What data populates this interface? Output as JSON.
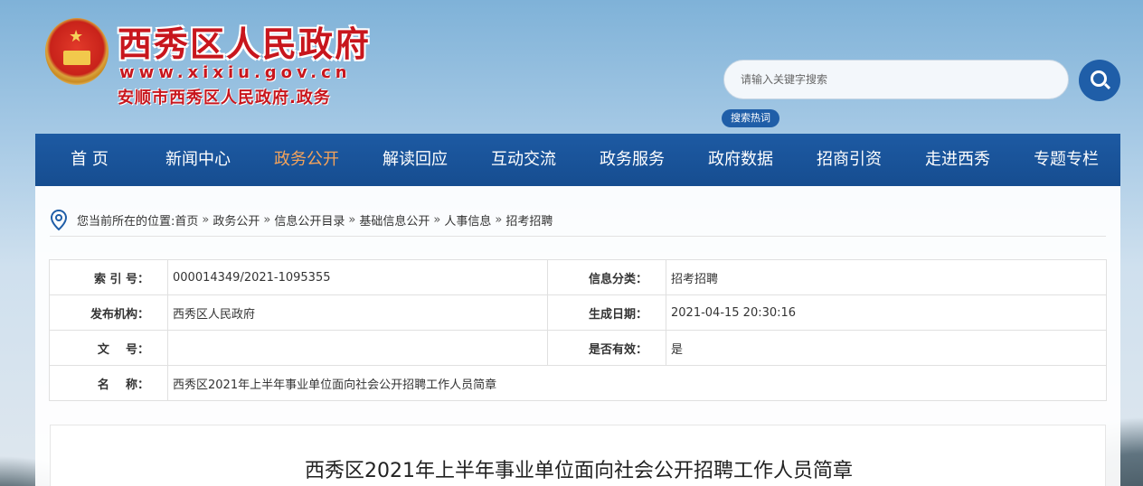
{
  "header": {
    "site_title": "西秀区人民政府",
    "site_url": "www.xixiu.gov.cn",
    "site_subtitle": "安顺市西秀区人民政府.政务"
  },
  "search": {
    "placeholder": "请输入关键字搜索",
    "hot_label": "搜索热词"
  },
  "nav": {
    "items": [
      "首 页",
      "新闻中心",
      "政务公开",
      "解读回应",
      "互动交流",
      "政务服务",
      "政府数据",
      "招商引资",
      "走进西秀",
      "专题专栏"
    ],
    "active": "政务公开",
    "active_color": "#f5a35a",
    "bar_color": "#1d5aa3"
  },
  "breadcrumb": {
    "prefix": "您当前所在的位置:",
    "items": [
      "首页",
      "政务公开",
      "信息公开目录",
      "基础信息公开",
      "人事信息",
      "招考招聘"
    ],
    "separator": "»"
  },
  "info": {
    "index_label": "索 引 号：",
    "index_value": "000014349/2021-1095355",
    "category_label": "信息分类：",
    "category_value": "招考招聘",
    "publisher_label": "发布机构：",
    "publisher_value": "西秀区人民政府",
    "date_label": "生成日期：",
    "date_value": "2021-04-15 20:30:16",
    "docno_label": "文    号：",
    "docno_value": "",
    "valid_label": "是否有效：",
    "valid_value": "是",
    "name_label": "名    称：",
    "name_value": "西秀区2021年上半年事业单位面向社会公开招聘工作人员简章"
  },
  "article": {
    "title": "西秀区2021年上半年事业单位面向社会公开招聘工作人员简章"
  },
  "colors": {
    "brand_red": "#c8161d",
    "brand_blue": "#1f5ea8"
  },
  "icons": {
    "search": "search-icon",
    "location": "location-pin-icon",
    "emblem": "national-emblem-icon"
  }
}
